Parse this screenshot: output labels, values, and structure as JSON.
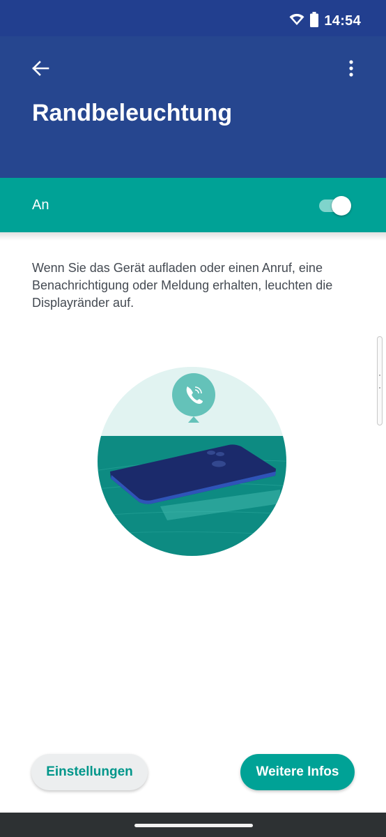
{
  "status_bar": {
    "time": "14:54",
    "icons": [
      "wifi-icon",
      "battery-icon"
    ]
  },
  "app_bar": {
    "title": "Randbeleuchtung",
    "back_icon": "arrow-back-icon",
    "menu_icon": "more-vert-icon"
  },
  "toggle": {
    "label": "An",
    "state": "on"
  },
  "description": "Wenn Sie das Gerät aufladen oder einen Anruf, eine Benachrichtigung oder Meldung erhalten, leuchten die Displayränder auf.",
  "illustration": {
    "icon": "phone-call-icon"
  },
  "buttons": {
    "settings_label": "Einstellungen",
    "info_label": "Weitere Infos"
  },
  "colors": {
    "status_bar": "#223f8f",
    "app_bar": "#26468f",
    "accent": "#00a296",
    "accent_light": "#7fd4cc"
  }
}
